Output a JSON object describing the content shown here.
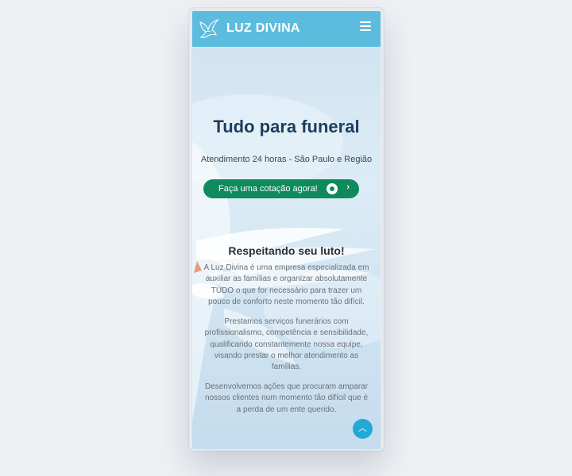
{
  "navbar": {
    "brand": "LUZ DIVINA",
    "logo_icon": "dove-icon",
    "menu_icon": "hamburger-menu-icon",
    "color": "#5bbcde"
  },
  "hero": {
    "title": "Tudo para funeral",
    "subtitle": "Atendimento 24 horas - São Paulo e Região",
    "cta_label": "Faça uma cotação agora!",
    "cta_icons": [
      "whatsapp-icon",
      "chevron-right-icon"
    ],
    "cta_color": "#0f8a5c"
  },
  "about": {
    "title": "Respeitando seu luto!",
    "paragraphs": [
      "A Luz Divina é uma empresa especializada em auxiliar as famílias e organizar absolutamente TUDO o que for necessário para trazer um pouco de conforto neste momento tão difícil.",
      "Prestamos serviços funerários com profissionalismo, competência e sensibilidade, qualificando constantemente nossa equipe, visando prestar o melhor atendimento as famílias.",
      "Desenvolvemos ações que procuram amparar nossos clientes num momento tão difícil que é a perda de um ente querido."
    ]
  },
  "back_to_top": {
    "icon": "chevron-up-icon",
    "color": "#23a9d5"
  }
}
